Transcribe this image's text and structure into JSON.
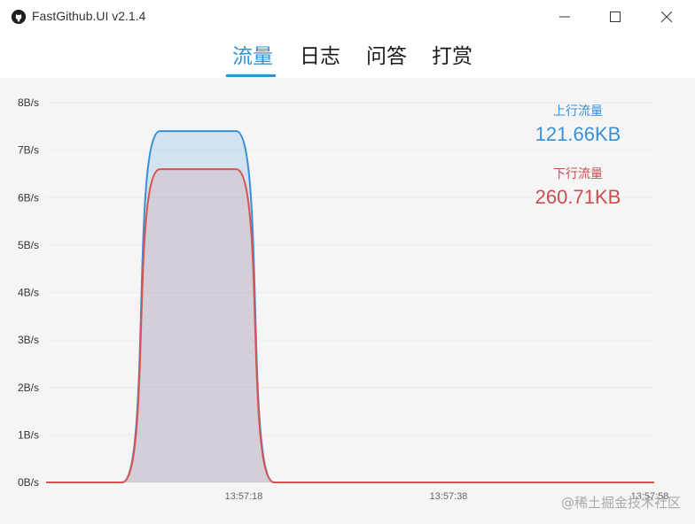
{
  "window": {
    "title": "FastGithub.UI v2.1.4"
  },
  "tabs": [
    {
      "label": "流量",
      "active": true
    },
    {
      "label": "日志",
      "active": false
    },
    {
      "label": "问答",
      "active": false
    },
    {
      "label": "打赏",
      "active": false
    }
  ],
  "stats": {
    "upload_label": "上行流量",
    "upload_value": "121.66KB",
    "download_label": "下行流量",
    "download_value": "260.71KB"
  },
  "watermark": "@稀土掘金技术社区",
  "colors": {
    "accent": "#2f93d8",
    "upload": "#3a8fd6",
    "download": "#d9534f"
  },
  "chart_data": {
    "type": "area",
    "y_ticks": [
      "0B/s",
      "1B/s",
      "2B/s",
      "3B/s",
      "4B/s",
      "5B/s",
      "6B/s",
      "7B/s",
      "8B/s"
    ],
    "ylim": [
      0,
      8
    ],
    "x_tick_labels": [
      "13:57:18",
      "13:57:38",
      "13:57:58"
    ],
    "x": [
      0,
      1,
      2,
      3,
      4,
      5,
      6,
      7,
      8,
      9,
      10,
      11,
      12,
      13,
      14,
      15,
      16
    ],
    "series": [
      {
        "values": [
          0,
          0,
          0,
          7.4,
          7.4,
          7.4,
          0,
          0,
          0,
          0,
          0,
          0,
          0,
          0,
          0,
          0,
          0
        ]
      },
      {
        "values": [
          0,
          0,
          0,
          6.6,
          6.6,
          6.6,
          0,
          0,
          0,
          0,
          0,
          0,
          0,
          0,
          0,
          0,
          0
        ]
      }
    ]
  }
}
